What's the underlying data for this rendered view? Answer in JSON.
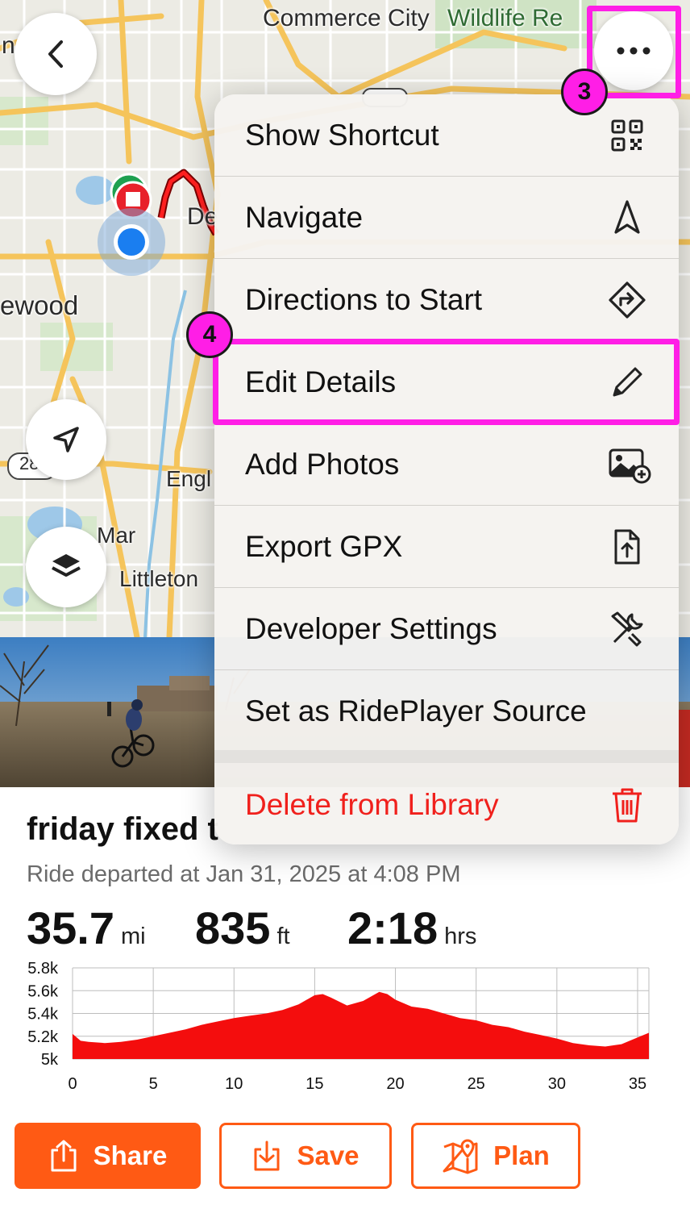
{
  "map": {
    "labels": {
      "commerce_city": "Commerce City",
      "wildlife": "Wildlife Re",
      "den": "De",
      "wood": "ewood",
      "engl": "Engl",
      "mar": "Mar",
      "littleton": "Littleton",
      "hwy": "28",
      "left_edge": "n"
    }
  },
  "menu": {
    "items": [
      {
        "label": "Show Shortcut",
        "icon": "qr-code-icon"
      },
      {
        "label": "Navigate",
        "icon": "navigate-arrow-icon"
      },
      {
        "label": "Directions to Start",
        "icon": "directions-icon"
      },
      {
        "label": "Edit Details",
        "icon": "pencil-icon"
      },
      {
        "label": "Add Photos",
        "icon": "add-photo-icon"
      },
      {
        "label": "Export GPX",
        "icon": "export-file-icon"
      },
      {
        "label": "Developer Settings",
        "icon": "tools-icon"
      },
      {
        "label": "Set as RidePlayer Source",
        "icon": ""
      }
    ],
    "delete_label": "Delete from Library",
    "delete_color": "#f0201c"
  },
  "annotations": {
    "step3": "3",
    "step4": "4",
    "color": "#ff1ee6"
  },
  "ride": {
    "title": "friday fixed t",
    "subtitle": "Ride departed at Jan 31, 2025 at 4:08 PM",
    "distance": {
      "value": "35.7",
      "unit": "mi"
    },
    "elevation": {
      "value": "835",
      "unit": "ft"
    },
    "duration": {
      "value": "2:18",
      "unit": "hrs"
    }
  },
  "chart_data": {
    "type": "area",
    "fill_color": "#f40d0d",
    "ylim": [
      5000,
      5800
    ],
    "y_ticks": [
      "5.8k",
      "5.6k",
      "5.4k",
      "5.2k",
      "5k"
    ],
    "y_tick_values": [
      5800,
      5600,
      5400,
      5200,
      5000
    ],
    "x_ticks": [
      "0",
      "5",
      "10",
      "15",
      "20",
      "25",
      "30",
      "35"
    ],
    "x_tick_values": [
      0,
      5,
      10,
      15,
      20,
      25,
      30,
      35
    ],
    "xlim": [
      0,
      35.7
    ],
    "x": [
      0,
      0.5,
      1,
      2,
      3,
      4,
      5,
      6,
      7,
      8,
      9,
      10,
      11,
      12,
      13,
      14,
      15,
      15.5,
      16,
      17,
      18,
      19,
      19.5,
      20,
      21,
      22,
      23,
      24,
      25,
      26,
      27,
      28,
      29,
      30,
      31,
      32,
      33,
      34,
      35,
      35.7
    ],
    "y": [
      5220,
      5160,
      5150,
      5140,
      5150,
      5170,
      5200,
      5230,
      5260,
      5300,
      5330,
      5360,
      5380,
      5400,
      5430,
      5480,
      5560,
      5570,
      5540,
      5470,
      5510,
      5590,
      5570,
      5520,
      5460,
      5440,
      5400,
      5360,
      5340,
      5300,
      5280,
      5240,
      5210,
      5180,
      5140,
      5120,
      5110,
      5130,
      5190,
      5230
    ]
  },
  "buttons": {
    "share": "Share",
    "save": "Save",
    "plan": "Plan",
    "accent": "#ff5a14"
  }
}
